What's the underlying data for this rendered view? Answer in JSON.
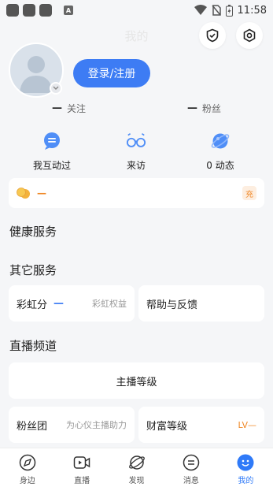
{
  "status_bar": {
    "time": "11:58",
    "a_badge": "A"
  },
  "header": {
    "title": "我的"
  },
  "profile": {
    "login_label": "登录/注册"
  },
  "stats": [
    {
      "value": "—",
      "label": "关注"
    },
    {
      "value": "—",
      "label": "粉丝"
    }
  ],
  "quick_actions": [
    {
      "label": "我互动过"
    },
    {
      "label": "来访"
    },
    {
      "label": "0 动态"
    }
  ],
  "coins": {
    "value": "—",
    "recharge_label": "充"
  },
  "sections": {
    "health": "健康服务",
    "other": "其它服务",
    "live": "直播频道"
  },
  "other_services": {
    "rainbow_label": "彩虹分",
    "rainbow_value": "—",
    "rainbow_rights": "彩虹权益",
    "help_label": "帮助与反馈"
  },
  "live_channel": {
    "anchor_level": "主播等级",
    "fan_group": "粉丝团",
    "fan_group_hint": "为心仪主播助力",
    "wealth_level": "财富等级",
    "wealth_value": "LV—"
  },
  "bottom_nav": [
    {
      "label": "身边",
      "icon": "compass-icon"
    },
    {
      "label": "直播",
      "icon": "video-icon"
    },
    {
      "label": "发现",
      "icon": "planet-icon"
    },
    {
      "label": "消息",
      "icon": "message-icon"
    },
    {
      "label": "我的",
      "icon": "profile-icon"
    }
  ],
  "colors": {
    "accent": "#3d7cf4",
    "orange": "#f08a2a",
    "background": "#f5f6f8"
  }
}
